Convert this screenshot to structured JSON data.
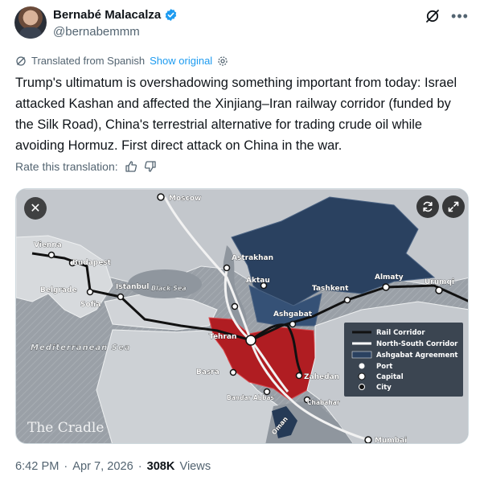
{
  "author": {
    "display_name": "Bernabé Malacalza",
    "handle": "@bernabemmm",
    "verified": true
  },
  "icons": {
    "verified": "verified-badge-icon",
    "grok": "grok-icon",
    "more": "more-dots-icon",
    "translate": "translate-icon",
    "settings": "gear-icon",
    "thumbs_up": "thumbs-up-icon",
    "thumbs_down": "thumbs-down-icon",
    "close": "close-icon",
    "refresh": "refresh-icon",
    "expand": "expand-icon"
  },
  "translation": {
    "label": "Translated from Spanish",
    "show_original": "Show original",
    "rate_label": "Rate this translation:"
  },
  "text": "Trump's ultimatum is overshadowing something important from today: Israel attacked Kashan and affected the Xinjiang–Iran railway corridor (funded by the Silk Road), China's terrestrial alternative for trading crude oil while avoiding Hormuz. First direct attack on China in the war.",
  "media": {
    "map_labels": {
      "moscow": "Moscow",
      "vienna": "Vienna",
      "budapest": "Budapest",
      "belgrade": "Belgrade",
      "sofia": "Sofia",
      "istanbul": "Istanbul",
      "black_sea": "Black Sea",
      "mediterranean": "Mediterranean Sea",
      "astrakhan": "Astrakhan",
      "aktau": "Aktau",
      "tashkent": "Tashkent",
      "almaty": "Almaty",
      "urumqi": "Urumqi",
      "ashgabat": "Ashgabat",
      "tehran": "Tehran",
      "basra": "Basra",
      "zahedan": "Zahedan",
      "bandar_abbas": "Bandar Abbas",
      "chabahar": "Chabahar",
      "mumbai": "Mumbai",
      "oman": "Oman",
      "watermark": "The Cradle"
    },
    "legend": {
      "rail": "Rail Corridor",
      "north_south": "North-South Corridor",
      "ashgabat": "Ashgabat Agreement",
      "port": "Port",
      "capital": "Capital",
      "city": "City"
    },
    "colors": {
      "iran": "#b01d22",
      "ashgabat_region": "#2a4160",
      "land": "#c8ccd1",
      "sea": "#8d949c"
    }
  },
  "footer": {
    "time": "6:42 PM",
    "separator": "·",
    "date": "Apr 7, 2026",
    "views_count": "308K",
    "views_label": "Views"
  }
}
